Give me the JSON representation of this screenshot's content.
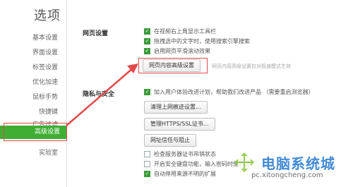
{
  "header": {
    "title": "选项"
  },
  "sidebar": {
    "items": [
      {
        "label": "基本设置"
      },
      {
        "label": "界面设置"
      },
      {
        "label": "标签设置"
      },
      {
        "label": "优化加速"
      },
      {
        "label": "鼠标手势"
      },
      {
        "label": "快捷键"
      },
      {
        "label": "广告过滤"
      },
      {
        "label": "高级设置",
        "active": true
      },
      {
        "label": "实验室"
      }
    ],
    "active_color": "#3fae33"
  },
  "web_settings": {
    "heading": "网页设置",
    "options": [
      {
        "label": "在视频右上角显示工具栏",
        "checked": true
      },
      {
        "label": "拖拽选中的文字时，使用搜索引擎搜索",
        "checked": true
      },
      {
        "label": "启用网页平滑滚动效果",
        "checked": true
      }
    ],
    "advanced_button": "网页内容高级设置",
    "advanced_hint": "网页内容高级设置仅对极速模式生效"
  },
  "privacy": {
    "heading": "隐私与安全",
    "join_option": {
      "label": "加入用户体验改进计划，帮助我们改进产品 （需要重启浏览器）",
      "checked": true
    },
    "clear_button": "清理上网痕迹设置...",
    "ssl_button": "管理HTTPS/SSL证书...",
    "trust_button": "网址信任与阻止",
    "options": [
      {
        "label": "检查服务器证书吊销状态",
        "checked": false
      },
      {
        "label": "开启安全键盘功能，输入密码时使用虚",
        "checked": false
      },
      {
        "label": "自动停用来源不明的扩展",
        "checked": true
      }
    ]
  },
  "annotation": {
    "color": "#e24848"
  },
  "watermark": {
    "title": "电脑系统城",
    "url": "pc.xitongcheng.com"
  }
}
